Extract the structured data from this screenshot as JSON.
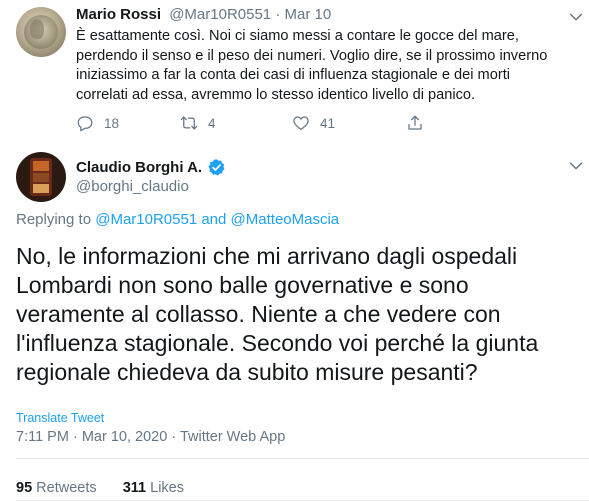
{
  "reply_tweet": {
    "author_name": "Mario Rossi",
    "handle": "@Mar10R0551",
    "separator": "·",
    "date": "Mar 10",
    "text": "È esattamente così. Noi ci siamo messi a contare le gocce del mare, perdendo il senso e il peso dei numeri. Voglio dire, se il prossimo inverno iniziassimo a far la conta dei casi di influenza stagionale e dei morti correlati ad essa, avremmo lo stesso identico livello di panico.",
    "reply_count": "18",
    "retweet_count": "4",
    "like_count": "41"
  },
  "main_tweet": {
    "author_name": "Claudio Borghi A.",
    "handle": "@borghi_claudio",
    "replying_prefix": "Replying to",
    "replying_to_1": "@Mar10R0551",
    "replying_and": "and",
    "replying_to_2": "@MatteoMascia",
    "text": "No, le informazioni che mi arrivano dagli ospedali Lombardi non sono balle governative e sono veramente al collasso. Niente a che vedere con l'influenza stagionale. Secondo voi perché la giunta regionale chiedeva da subito misure pesanti?",
    "translate_label": "Translate Tweet",
    "time": "7:11 PM",
    "separator": "·",
    "date": "Mar 10, 2020",
    "client": "Twitter Web App",
    "retweets_count": "95",
    "retweets_label": "Retweets",
    "likes_count": "311",
    "likes_label": "Likes"
  },
  "colors": {
    "accent": "#1da1f2",
    "muted": "#657786",
    "text": "#14171a",
    "divider": "#e6ecf0"
  },
  "icons": [
    "chevron-down-icon",
    "reply-icon",
    "retweet-icon",
    "like-icon",
    "share-icon",
    "verified-badge-icon"
  ]
}
